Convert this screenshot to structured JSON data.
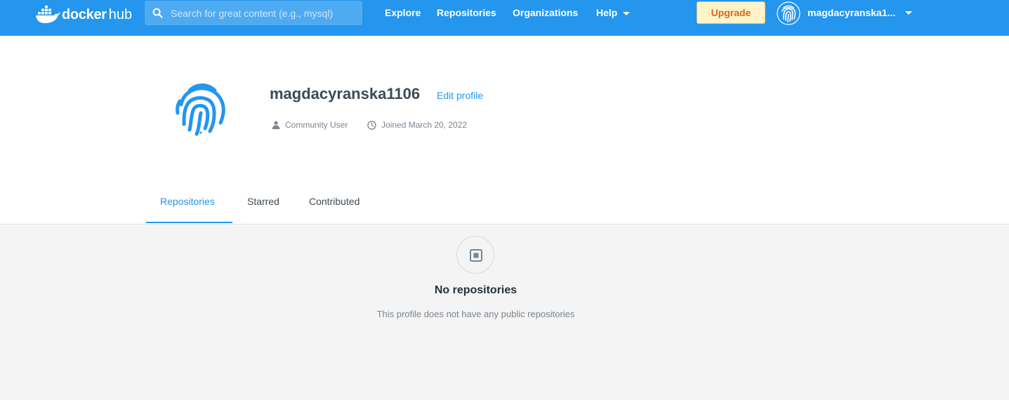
{
  "header": {
    "logo_word": "docker",
    "logo_hub": "hub",
    "search_placeholder": "Search for great content (e.g., mysql)",
    "nav": [
      "Explore",
      "Repositories",
      "Organizations",
      "Help"
    ],
    "upgrade_label": "Upgrade",
    "username": "magdacyranska1106",
    "username_display": "magdacyranska1...",
    "brand_color": "#2496ed"
  },
  "profile": {
    "name": "magdacyranska1106",
    "edit_label": "Edit profile",
    "role": "Community User",
    "joined": "Joined March 20, 2022",
    "avatar_icon": "fingerprint-icon"
  },
  "tabs": [
    "Repositories",
    "Starred",
    "Contributed"
  ],
  "active_tab": "Repositories",
  "empty_state": {
    "icon": "repository-icon",
    "title": "No repositories",
    "subtitle": "This profile does not have any public repositories"
  }
}
